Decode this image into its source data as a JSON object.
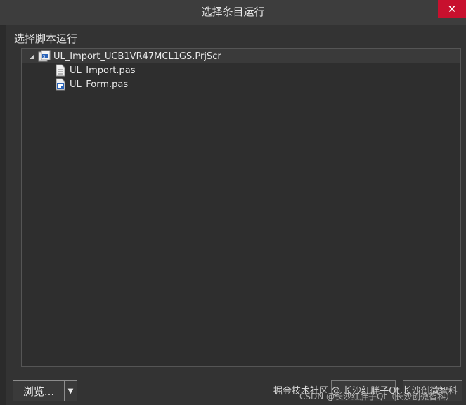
{
  "window": {
    "title": "选择条目运行",
    "close_glyph": "✕"
  },
  "section_label": "选择脚本运行",
  "tree": {
    "root": {
      "expander_glyph": "◢",
      "icon": "script-project-icon",
      "label": "UL_Import_UCB1VR47MCL1GS.PrjScr"
    },
    "children": [
      {
        "icon": "pascal-file-icon",
        "label": "UL_Import.pas"
      },
      {
        "icon": "form-file-icon",
        "label": "UL_Form.pas"
      }
    ]
  },
  "footer": {
    "browse_label": "浏览...",
    "browse_arrow_glyph": "▼"
  },
  "watermark": {
    "line1": "掘金技术社区 @ 长沙红胖子Qt 长沙创微智科",
    "line2": "CSDN @长沙红胖子Qt（长沙创微智科）"
  },
  "colors": {
    "close_button": "#c8102e",
    "background": "#333333",
    "panel": "#2e2e2e"
  }
}
